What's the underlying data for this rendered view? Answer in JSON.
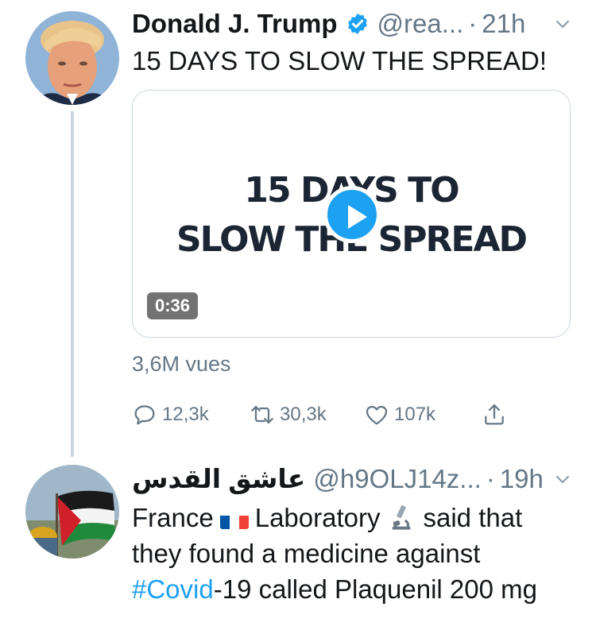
{
  "tweets": [
    {
      "name": "Donald J. Trump",
      "verified": true,
      "handle": "@rea...",
      "separator": "·",
      "time": "21h",
      "text": "15 DAYS TO SLOW THE SPREAD!",
      "media": {
        "title_line1": "15 DAYS TO",
        "title_line2": "SLOW THE SPREAD",
        "duration": "0:36"
      },
      "views": "3,6M vues",
      "actions": {
        "replies": "12,3k",
        "retweets": "30,3k",
        "likes": "107k"
      }
    },
    {
      "name": "عاشق القدس",
      "handle": "@h9OLJ14z...",
      "separator": "·",
      "time": "19h",
      "text_part1": "France",
      "text_part2": "Laboratory",
      "text_part3": "said that they found a medicine against",
      "hashtag": "#Covid",
      "text_part4": "-19 called Plaquenil 200 mg"
    }
  ],
  "colors": {
    "accent": "#1da1f2",
    "secondary_text": "#657786",
    "thread_line": "#ccd6dd"
  },
  "icons": [
    "verified-badge-icon",
    "chevron-down-icon",
    "reply-icon",
    "retweet-icon",
    "like-icon",
    "share-icon",
    "play-icon",
    "france-flag-icon",
    "microscope-icon"
  ]
}
